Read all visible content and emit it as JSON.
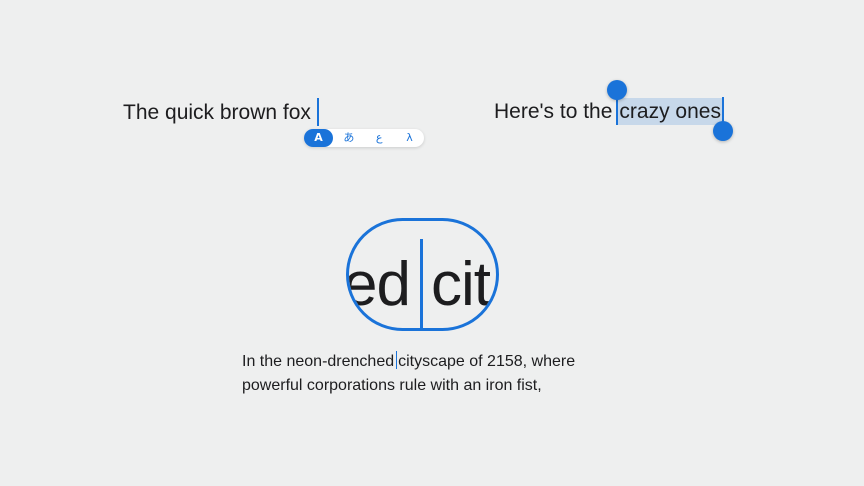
{
  "example_cursor": {
    "text": "The quick brown fox",
    "input_modes": [
      "A",
      "あ",
      "ع",
      "λ"
    ],
    "active_mode": "A"
  },
  "example_selection": {
    "prefix": "Here's to the",
    "selected": "crazy ones"
  },
  "example_loupe": {
    "magnified_before": "ed",
    "magnified_after": "cit",
    "paragraph": {
      "line1_before": "In the neon-drenched",
      "line1_after": "cityscape of 2158, where",
      "line2": "powerful corporations rule with an iron fist,"
    }
  },
  "colors": {
    "background": "#eeefef",
    "accent": "#1a73d9",
    "selection": "#c7d8ea",
    "text": "#1d1d1f"
  }
}
